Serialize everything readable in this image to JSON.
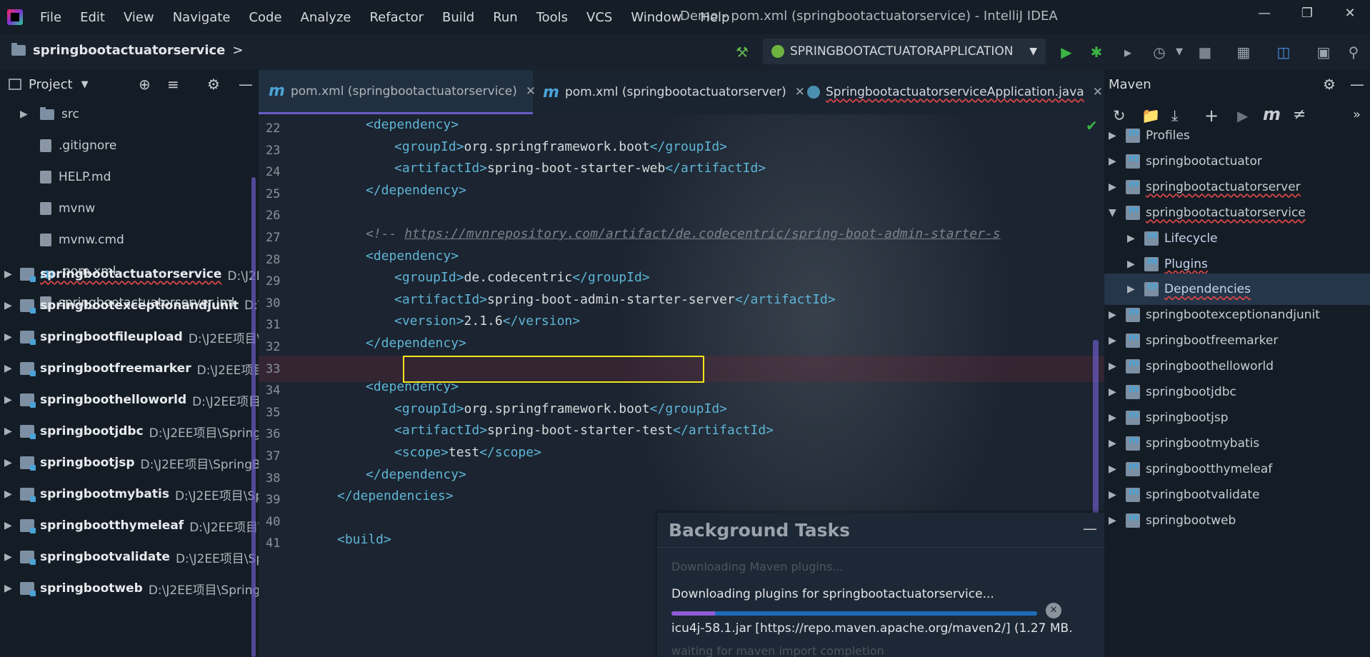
{
  "menubar": {
    "items": [
      "File",
      "Edit",
      "View",
      "Navigate",
      "Code",
      "Analyze",
      "Refactor",
      "Build",
      "Run",
      "Tools",
      "VCS",
      "Window",
      "Help"
    ],
    "window_title": "Demo - pom.xml (springbootactuatorservice) - IntelliJ IDEA"
  },
  "navbar": {
    "breadcrumb": "springbootactuatorservice",
    "run_config": "SPRINGBOOTACTUATORAPPLICATION"
  },
  "project": {
    "title": "Project",
    "files": [
      {
        "name": "src",
        "icon": "folder-icon"
      },
      {
        "name": ".gitignore",
        "icon": "gitignore-file-icon"
      },
      {
        "name": "HELP.md",
        "icon": "markdown-file-icon"
      },
      {
        "name": "mvnw",
        "icon": "script-file-icon"
      },
      {
        "name": "mvnw.cmd",
        "icon": "script-file-icon"
      },
      {
        "name": "pom.xml",
        "icon": "maven-file-icon"
      },
      {
        "name": "springbootactuatorserver.iml",
        "icon": "iml-file-icon"
      }
    ],
    "modules": [
      {
        "name": "springbootactuatorservice",
        "path": "D:\\J2EE项"
      },
      {
        "name": "springbootexceptionandjunit",
        "path": "D:\\J2E"
      },
      {
        "name": "springbootfileupload",
        "path": "D:\\J2EE项目\\Sp"
      },
      {
        "name": "springbootfreemarker",
        "path": "D:\\J2EE项目\\S"
      },
      {
        "name": "springboothelloworld",
        "path": "D:\\J2EE项目\\Sp"
      },
      {
        "name": "springbootjdbc",
        "path": "D:\\J2EE项目\\SpringBo"
      },
      {
        "name": "springbootjsp",
        "path": "D:\\J2EE项目\\SpringBoo"
      },
      {
        "name": "springbootmybatis",
        "path": "D:\\J2EE项目\\Spri"
      },
      {
        "name": "springbootthymeleaf",
        "path": "D:\\J2EE项目\\Sp"
      },
      {
        "name": "springbootvalidate",
        "path": "D:\\J2EE项目\\Spri"
      },
      {
        "name": "springbootweb",
        "path": "D:\\J2EE项目\\SpringBo"
      }
    ]
  },
  "editor": {
    "tabs": [
      {
        "label": "pom.xml (springbootactuatorservice)",
        "active": true
      },
      {
        "label": "pom.xml (springbootactuatorserver)",
        "active": false
      },
      {
        "label": "SpringbootactuatorserviceApplication.java",
        "active": false
      }
    ],
    "line_numbers": [
      "22",
      "23",
      "24",
      "25",
      "26",
      "27",
      "28",
      "29",
      "30",
      "31",
      "32",
      "33",
      "34",
      "35",
      "36",
      "37",
      "38",
      "39",
      "40",
      "41"
    ],
    "lines": [
      {
        "indent": 1,
        "parts": [
          [
            "tg",
            "<"
          ],
          [
            "tg",
            "dependency"
          ],
          [
            "tg",
            ">"
          ]
        ]
      },
      {
        "indent": 2,
        "parts": [
          [
            "tg",
            "<groupId>"
          ],
          [
            "tx",
            "org.springframework.boot"
          ],
          [
            "tg",
            "</groupId>"
          ]
        ]
      },
      {
        "indent": 2,
        "parts": [
          [
            "tg",
            "<artifactId>"
          ],
          [
            "tx",
            "spring-boot-starter-web"
          ],
          [
            "tg",
            "</artifactId>"
          ]
        ]
      },
      {
        "indent": 1,
        "parts": [
          [
            "tg",
            "</dependency>"
          ]
        ]
      },
      {
        "indent": 0,
        "parts": []
      },
      {
        "indent": 1,
        "parts": [
          [
            "cm",
            "<!-- "
          ],
          [
            "url",
            "https://mvnrepository.com/artifact/de.codecentric/spring-boot-admin-starter-s"
          ]
        ]
      },
      {
        "indent": 1,
        "parts": [
          [
            "tg",
            "<dependency>"
          ]
        ]
      },
      {
        "indent": 2,
        "parts": [
          [
            "tg",
            "<groupId>"
          ],
          [
            "tx",
            "de.codecentric"
          ],
          [
            "tg",
            "</groupId>"
          ]
        ]
      },
      {
        "indent": 2,
        "parts": [
          [
            "tg",
            "<artifactId>"
          ],
          [
            "tx",
            "spring-boot-admin-starter-server"
          ],
          [
            "tg",
            "</artifactId>"
          ]
        ]
      },
      {
        "indent": 2,
        "parts": [
          [
            "tg",
            "<version>"
          ],
          [
            "tx",
            "2.1.6"
          ],
          [
            "tg",
            "</version>"
          ]
        ]
      },
      {
        "indent": 1,
        "parts": [
          [
            "tg",
            "</dependency>"
          ]
        ]
      },
      {
        "indent": 0,
        "parts": []
      },
      {
        "indent": 1,
        "parts": [
          [
            "tg",
            "<dependency>"
          ]
        ]
      },
      {
        "indent": 2,
        "parts": [
          [
            "tg",
            "<groupId>"
          ],
          [
            "tx",
            "org.springframework.boot"
          ],
          [
            "tg",
            "</groupId>"
          ]
        ]
      },
      {
        "indent": 2,
        "parts": [
          [
            "tg",
            "<artifactId>"
          ],
          [
            "tx",
            "spring-boot-starter-test"
          ],
          [
            "tg",
            "</artifactId>"
          ]
        ]
      },
      {
        "indent": 2,
        "parts": [
          [
            "tg",
            "<scope>"
          ],
          [
            "tx",
            "test"
          ],
          [
            "tg",
            "</scope>"
          ]
        ]
      },
      {
        "indent": 1,
        "parts": [
          [
            "tg",
            "</dependency>"
          ]
        ]
      },
      {
        "indent": 0,
        "parts": [
          [
            "tg",
            "</dependencies>"
          ]
        ]
      },
      {
        "indent": 0,
        "parts": []
      },
      {
        "indent": 0,
        "parts": [
          [
            "tg",
            "<build>"
          ]
        ]
      }
    ]
  },
  "bg_tasks": {
    "title": "Background Tasks",
    "faded_task": "Downloading Maven plugins...",
    "task": "Downloading plugins for springbootactuatorservice...",
    "detail": "icu4j-58.1.jar [https://repo.maven.apache.org/maven2/]  (1.27 MB...",
    "faded_bottom": "waiting for maven import completion",
    "progress": 0.12,
    "accent": "#8e5bd6"
  },
  "maven": {
    "title": "Maven",
    "items": [
      {
        "label": "Profiles",
        "level": 0,
        "expanded": false,
        "squig": false
      },
      {
        "label": "springbootactuator",
        "level": 0,
        "expanded": false,
        "squig": false
      },
      {
        "label": "springbootactuatorserver",
        "level": 0,
        "expanded": false,
        "squig": true
      },
      {
        "label": "springbootactuatorservice",
        "level": 0,
        "expanded": true,
        "squig": true
      },
      {
        "label": "Lifecycle",
        "level": 1,
        "expanded": false,
        "squig": false
      },
      {
        "label": "Plugins",
        "level": 1,
        "expanded": false,
        "squig": true
      },
      {
        "label": "Dependencies",
        "level": 1,
        "expanded": false,
        "squig": true,
        "selected": true
      },
      {
        "label": "springbootexceptionandjunit",
        "level": 0,
        "expanded": false,
        "squig": false
      },
      {
        "label": "springbootfreemarker",
        "level": 0,
        "expanded": false,
        "squig": false
      },
      {
        "label": "springboothelloworld",
        "level": 0,
        "expanded": false,
        "squig": false
      },
      {
        "label": "springbootjdbc",
        "level": 0,
        "expanded": false,
        "squig": false
      },
      {
        "label": "springbootjsp",
        "level": 0,
        "expanded": false,
        "squig": false
      },
      {
        "label": "springbootmybatis",
        "level": 0,
        "expanded": false,
        "squig": false
      },
      {
        "label": "springbootthymeleaf",
        "level": 0,
        "expanded": false,
        "squig": false
      },
      {
        "label": "springbootvalidate",
        "level": 0,
        "expanded": false,
        "squig": false
      },
      {
        "label": "springbootweb",
        "level": 0,
        "expanded": false,
        "squig": false
      }
    ]
  },
  "colors": {
    "accent": "#6b5cc8",
    "highlight_box": "#f2e61a",
    "tag": "#5fb5d6",
    "run_green": "#3cb545"
  }
}
